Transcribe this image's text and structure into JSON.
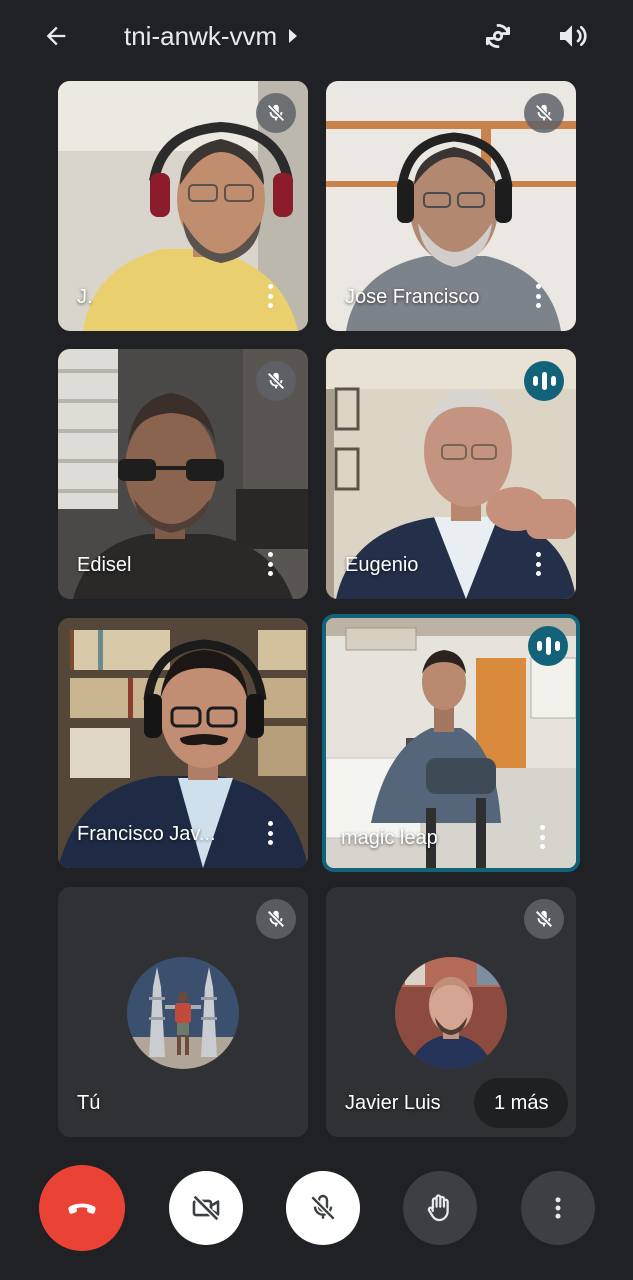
{
  "header": {
    "meeting_code": "tni-anwk-vvm"
  },
  "participants": [
    {
      "name": "J.",
      "muted": true,
      "speaking": false,
      "video": true
    },
    {
      "name": "Jose Francisco",
      "muted": true,
      "speaking": false,
      "video": true
    },
    {
      "name": "Edisel",
      "muted": true,
      "speaking": false,
      "video": true
    },
    {
      "name": "Eugenio",
      "muted": false,
      "speaking": true,
      "video": true
    },
    {
      "name": "Francisco Jav...",
      "muted": false,
      "speaking": false,
      "video": true
    },
    {
      "name": "magic leap",
      "muted": false,
      "speaking": true,
      "video": true,
      "active_speaker": true
    },
    {
      "name": "Tú",
      "muted": true,
      "speaking": false,
      "video": false
    },
    {
      "name": "Javier Luis",
      "muted": true,
      "speaking": false,
      "video": false
    }
  ],
  "overflow": {
    "label": "1 más"
  },
  "controls": [
    {
      "icon": "hang-up-icon"
    },
    {
      "icon": "camera-off-icon"
    },
    {
      "icon": "mic-off-icon"
    },
    {
      "icon": "raise-hand-icon"
    },
    {
      "icon": "more-options-icon"
    }
  ],
  "colors": {
    "background": "#202124",
    "tile_empty": "#303134",
    "hangup": "#ea4335",
    "active_speaker": "#12637a"
  }
}
